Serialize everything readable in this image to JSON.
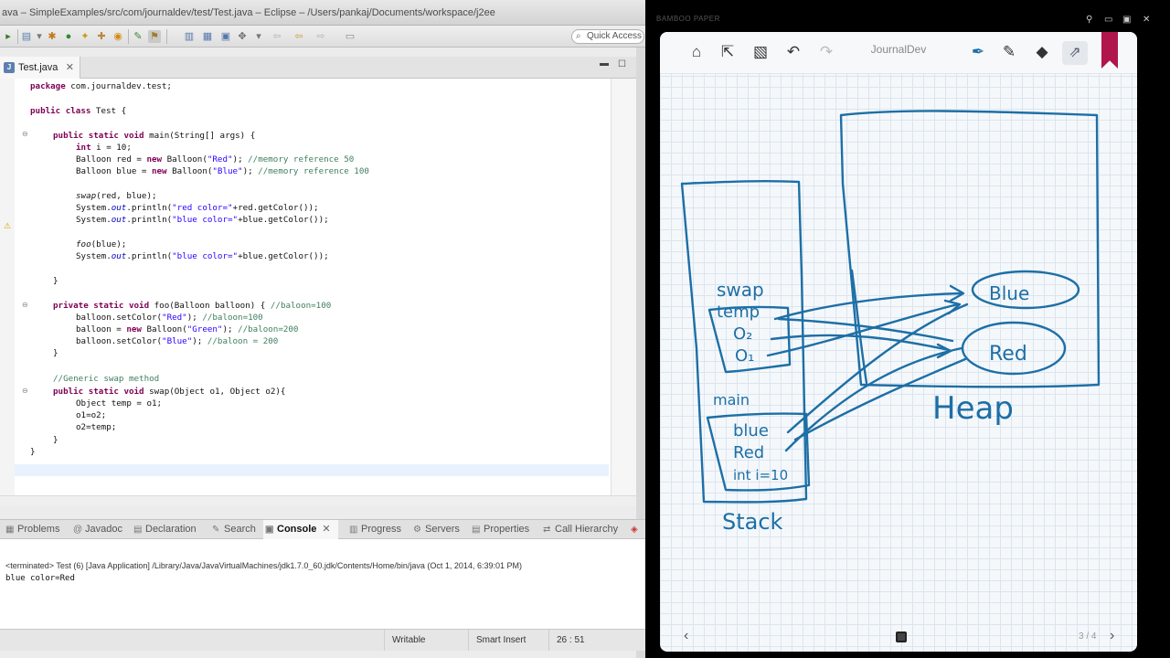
{
  "eclipse": {
    "title": "ava – SimpleExamples/src/com/journaldev/test/Test.java – Eclipse – /Users/pankaj/Documents/workspace/j2ee",
    "quick_access": "Quick Access",
    "editor_tab": "Test.java",
    "code": {
      "l1_kw": "package",
      "l1_rest": " com.journaldev.test;",
      "l2_kw": "public class",
      "l2_rest": " Test {",
      "l3_kw": "public static void",
      "l3_rest": " main(String[] args) {",
      "l4_kw": "int",
      "l4_rest": " i = 10;",
      "l5_a": "Balloon red = ",
      "l5_kw": "new",
      "l5_b": " Balloon(",
      "l5_str": "\"Red\"",
      "l5_c": "); ",
      "l5_com": "//memory reference 50",
      "l6_a": "Balloon blue = ",
      "l6_kw": "new",
      "l6_b": " Balloon(",
      "l6_str": "\"Blue\"",
      "l6_c": "); ",
      "l6_com": "//memory reference 100",
      "l7_it": "swap",
      "l7_rest": "(red, blue);",
      "l8_a": "System.",
      "l8_fld": "out",
      "l8_b": ".println(",
      "l8_str": "\"red color=\"",
      "l8_c": "+red.getColor());",
      "l9_a": "System.",
      "l9_fld": "out",
      "l9_b": ".println(",
      "l9_str": "\"blue color=\"",
      "l9_c": "+blue.getColor());",
      "l10_it": "foo",
      "l10_rest": "(blue);",
      "l11_a": "System.",
      "l11_fld": "out",
      "l11_b": ".println(",
      "l11_str": "\"blue color=\"",
      "l11_c": "+blue.getColor());",
      "l12": "}",
      "l13_kw": "private static void",
      "l13_rest": " foo(Balloon balloon) { ",
      "l13_com": "//baloon=100",
      "l14_a": "balloon.setColor(",
      "l14_str": "\"Red\"",
      "l14_b": "); ",
      "l14_com": "//baloon=100",
      "l15_a": "balloon = ",
      "l15_kw": "new",
      "l15_b": " Balloon(",
      "l15_str": "\"Green\"",
      "l15_c": "); ",
      "l15_com": "//baloon=200",
      "l16_a": "balloon.setColor(",
      "l16_str": "\"Blue\"",
      "l16_b": "); ",
      "l16_com": "//baloon = 200",
      "l17": "}",
      "l18_com": "//Generic swap method",
      "l19_kw": "public static void",
      "l19_rest": " swap(Object o1, Object o2){",
      "l20": "Object temp = o1;",
      "l21": "o1=o2;",
      "l22": "o2=temp;",
      "l23": "}",
      "l24": "}"
    },
    "bottom_tabs": {
      "problems": "Problems",
      "javadoc": "Javadoc",
      "declaration": "Declaration",
      "search": "Search",
      "console": "Console",
      "progress": "Progress",
      "servers": "Servers",
      "properties": "Properties",
      "call_hierarchy": "Call Hierarchy"
    },
    "console": {
      "description": "<terminated> Test (6) [Java Application] /Library/Java/JavaVirtualMachines/jdk1.7.0_60.jdk/Contents/Home/bin/java (Oct 1, 2014, 6:39:01 PM)",
      "output": "blue color=Red"
    },
    "status": {
      "writable": "Writable",
      "insert_mode": "Smart Insert",
      "position": "26 : 51"
    }
  },
  "bamboo": {
    "app_label": "BAMBOO PAPER",
    "notebook_name": "JournalDev",
    "page_indicator": "3 / 4",
    "sketch_labels": {
      "swap": "swap",
      "temp": "temp",
      "o2": "O₂",
      "o1": "O₁",
      "main": "main",
      "blue": "blue",
      "red": "Red",
      "int": "int i=10",
      "stack": "Stack",
      "heap": "Heap",
      "heap_blue": "Blue",
      "heap_red": "Red"
    },
    "ink_color": "#1d6fa6"
  }
}
